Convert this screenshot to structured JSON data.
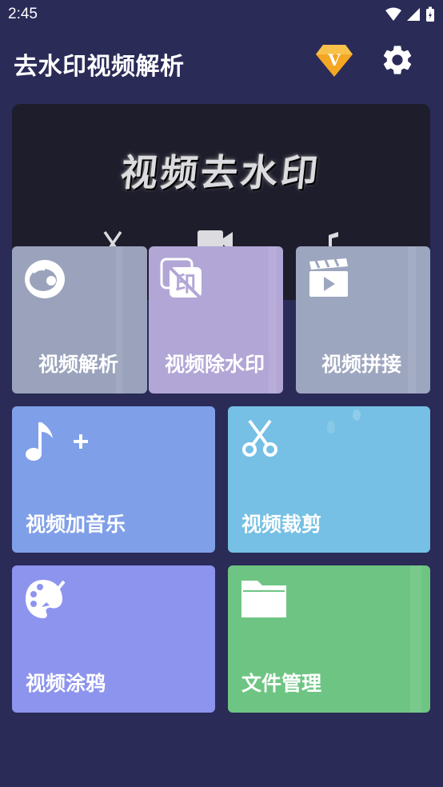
{
  "status": {
    "time": "2:45"
  },
  "header": {
    "title": "去水印视频解析"
  },
  "banner": {
    "title": "视频去水印"
  },
  "tiles": [
    {
      "label": "视频解析",
      "icon": "video-parse-icon",
      "color": "#9aa3bb"
    },
    {
      "label": "视频除水印",
      "icon": "no-watermark-icon",
      "color": "#b2a6d6"
    },
    {
      "label": "视频拼接",
      "icon": "clapperboard-icon",
      "color": "#9da6bf"
    },
    {
      "label": "视频加音乐",
      "icon": "music-add-icon",
      "color": "#7f9fe9"
    },
    {
      "label": "视频裁剪",
      "icon": "scissors-icon",
      "color": "#75c0e4"
    },
    {
      "label": "视频涂鸦",
      "icon": "palette-icon",
      "color": "#8d94ee"
    },
    {
      "label": "文件管理",
      "icon": "folder-icon",
      "color": "#6ec583"
    }
  ],
  "colors": {
    "background": "#2a2b57",
    "vip": "#f3a623"
  }
}
